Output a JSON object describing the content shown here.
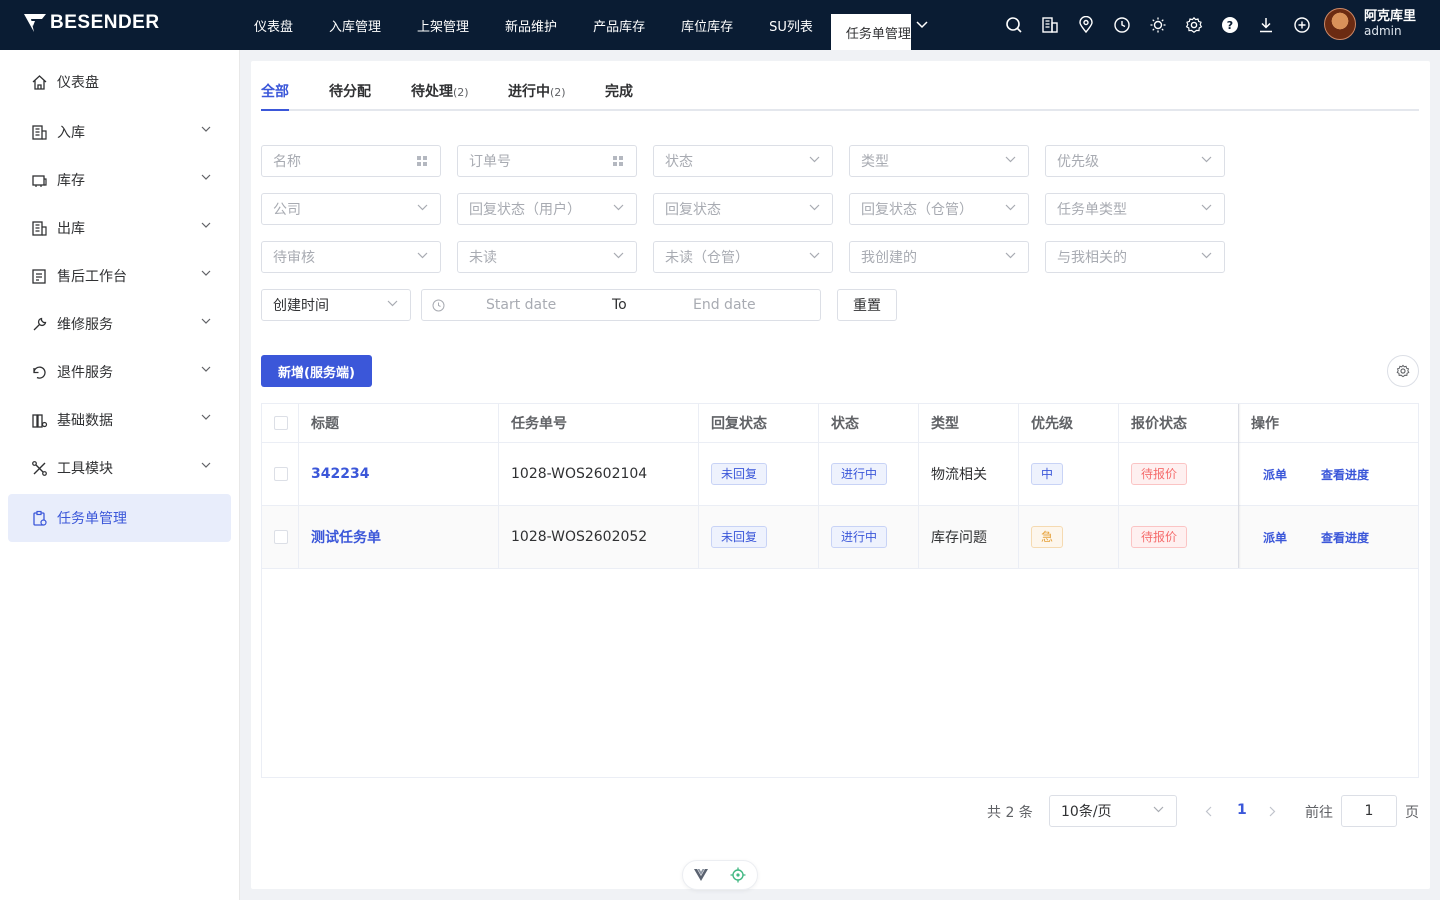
{
  "brand": {
    "logo_text": "BESENDER"
  },
  "topnav": {
    "items": [
      "仪表盘",
      "入库管理",
      "上架管理",
      "新品维护",
      "产品库存",
      "库位库存",
      "SU列表"
    ],
    "active": "任务单管理"
  },
  "topicons": [
    "search-icon",
    "building-icon",
    "location-icon",
    "clock-icon",
    "sun-icon",
    "gear-icon",
    "help-icon",
    "download-icon",
    "plus-circle-icon"
  ],
  "user": {
    "name": "阿克库里",
    "role": "admin"
  },
  "sidebar": {
    "items": [
      {
        "label": "仪表盘",
        "icon": "home-icon",
        "expandable": false
      },
      {
        "label": "入库",
        "icon": "inbound-icon",
        "expandable": true
      },
      {
        "label": "库存",
        "icon": "inventory-icon",
        "expandable": true
      },
      {
        "label": "出库",
        "icon": "outbound-icon",
        "expandable": true
      },
      {
        "label": "售后工作台",
        "icon": "after-sales-icon",
        "expandable": true
      },
      {
        "label": "维修服务",
        "icon": "wrench-icon",
        "expandable": true
      },
      {
        "label": "退件服务",
        "icon": "return-icon",
        "expandable": true
      },
      {
        "label": "基础数据",
        "icon": "data-icon",
        "expandable": true
      },
      {
        "label": "工具模块",
        "icon": "tools-icon",
        "expandable": true
      },
      {
        "label": "任务单管理",
        "icon": "clipboard-icon",
        "expandable": false
      }
    ]
  },
  "tabs": [
    {
      "label": "全部",
      "count": ""
    },
    {
      "label": "待分配",
      "count": ""
    },
    {
      "label": "待处理",
      "count": "(2)"
    },
    {
      "label": "进行中",
      "count": "(2)"
    },
    {
      "label": "完成",
      "count": ""
    }
  ],
  "filters": {
    "row1": [
      "名称",
      "订单号",
      "状态",
      "类型",
      "优先级"
    ],
    "row2": [
      "公司",
      "回复状态（用户）",
      "回复状态",
      "回复状态（仓管）",
      "任务单类型"
    ],
    "row3": [
      "待审核",
      "未读",
      "未读（仓管）",
      "我创建的",
      "与我相关的"
    ],
    "time_type": "创建时间",
    "start_placeholder": "Start date",
    "range_sep": "To",
    "end_placeholder": "End date",
    "reset": "重置"
  },
  "actions": {
    "add": "新增(服务端)"
  },
  "table": {
    "columns": [
      "标题",
      "任务单号",
      "回复状态",
      "状态",
      "类型",
      "优先级",
      "报价状态",
      "操作"
    ],
    "rows": [
      {
        "title": "342234",
        "no": "1028-WOS2602104",
        "reply": "未回复",
        "status": "进行中",
        "type": "物流相关",
        "priority": "中",
        "quote": "待报价",
        "op1": "派单",
        "op2": "查看进度"
      },
      {
        "title": "测试任务单",
        "no": "1028-WOS2602052",
        "reply": "未回复",
        "status": "进行中",
        "type": "库存问题",
        "priority": "急",
        "quote": "待报价",
        "op1": "派单",
        "op2": "查看进度"
      }
    ]
  },
  "pagination": {
    "total": "共 2 条",
    "page_size": "10条/页",
    "current": "1",
    "goto_label": "前往",
    "goto_value": "1",
    "page_suffix": "页"
  }
}
